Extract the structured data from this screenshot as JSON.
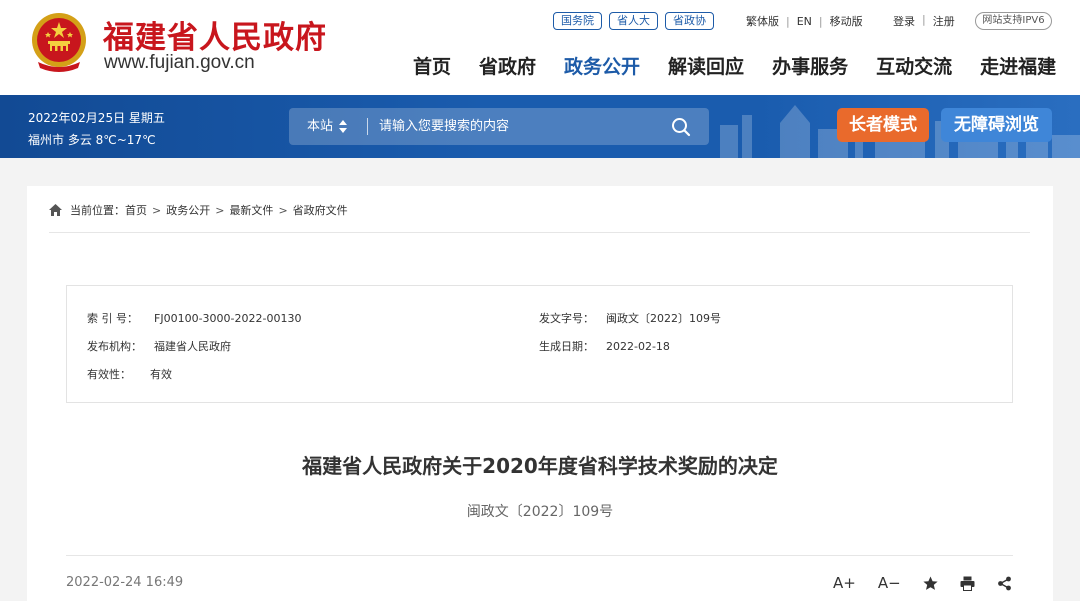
{
  "header": {
    "site_title": "福建省人民政府",
    "site_url": "www.fujian.gov.cn",
    "org_links": [
      "国务院",
      "省人大",
      "省政协"
    ],
    "util_links": [
      "繁体版",
      "EN",
      "移动版"
    ],
    "login_links": [
      "登录",
      "注册"
    ],
    "ipv6_badge": "网站支持IPV6",
    "nav": [
      {
        "label": "首页",
        "active": false
      },
      {
        "label": "省政府",
        "active": false
      },
      {
        "label": "政务公开",
        "active": true
      },
      {
        "label": "解读回应",
        "active": false
      },
      {
        "label": "办事服务",
        "active": false
      },
      {
        "label": "互动交流",
        "active": false
      },
      {
        "label": "走进福建",
        "active": false
      }
    ]
  },
  "banner": {
    "date": "2022年02月25日 星期五",
    "weather": "福州市 多云 8℃~17℃",
    "search_scope": "本站",
    "search_placeholder": "请输入您要搜索的内容",
    "elder_mode": "长者模式",
    "accessible": "无障碍浏览"
  },
  "breadcrumb": {
    "prefix": "当前位置：",
    "items": [
      "首页",
      "政务公开",
      "最新文件",
      "省政府文件"
    ]
  },
  "meta": {
    "index_label": "索 引 号：",
    "index_value": "FJ00100-3000-2022-00130",
    "doc_no_label": "发文字号：",
    "doc_no_value": "闽政文〔2022〕109号",
    "org_label": "发布机构：",
    "org_value": "福建省人民政府",
    "date_label": "生成日期：",
    "date_value": "2022-02-18",
    "validity_label": "有效性：",
    "validity_value": "有效"
  },
  "document": {
    "title": "福建省人民政府关于2020年度省科学技术奖励的决定",
    "number": "闽政文〔2022〕109号",
    "published": "2022-02-24 16:49"
  },
  "tools": {
    "font_increase": "A+",
    "font_decrease": "A−"
  },
  "colors": {
    "brand_red": "#c8161d",
    "brand_blue": "#1d5ba8",
    "banner_blue": "#1a5cae",
    "elder_orange": "#e96a2c",
    "access_blue": "#3f86d8"
  }
}
